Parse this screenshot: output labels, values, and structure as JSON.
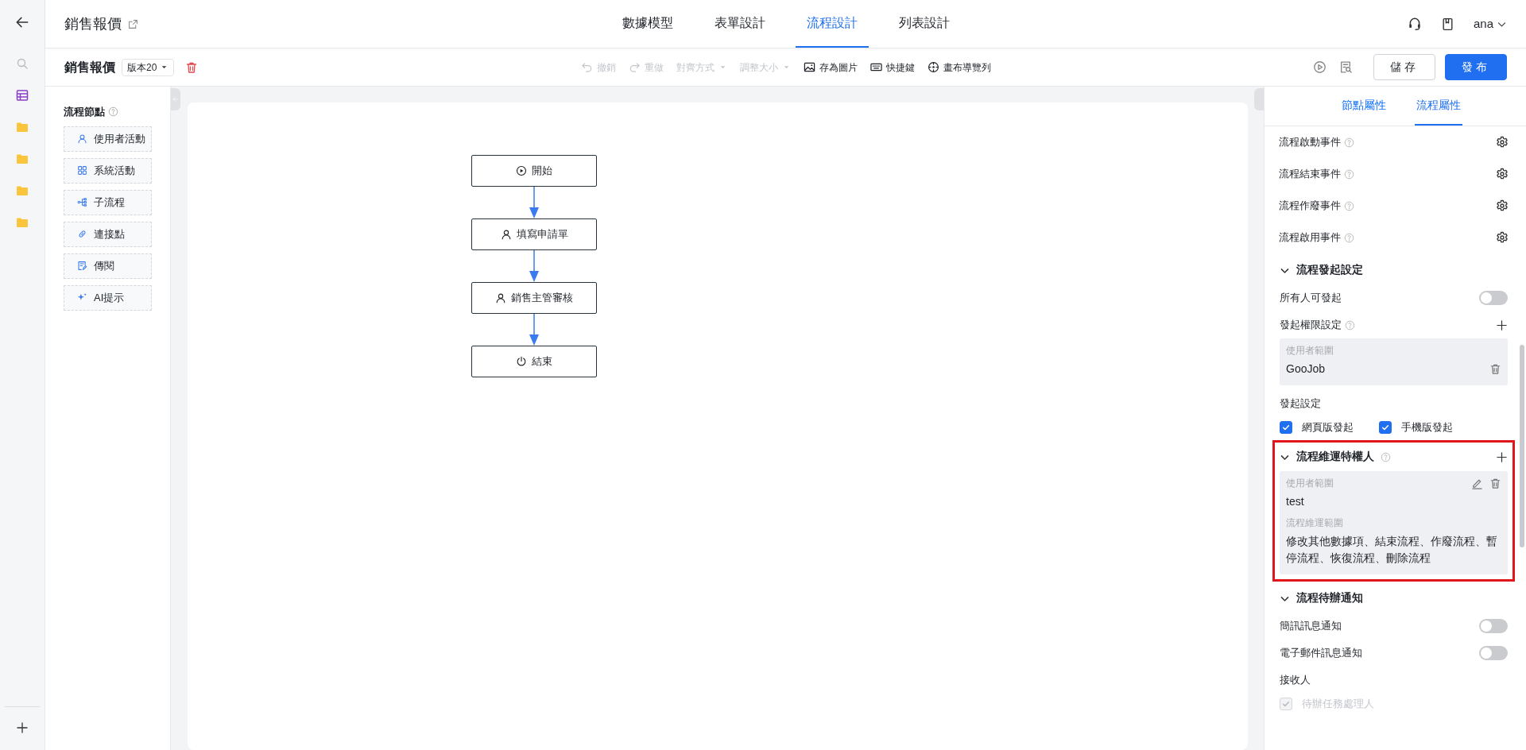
{
  "header": {
    "title": "銷售報價",
    "tabs": [
      {
        "label": "數據模型",
        "selected": false
      },
      {
        "label": "表單設計",
        "selected": false
      },
      {
        "label": "流程設計",
        "selected": true
      },
      {
        "label": "列表設計",
        "selected": false
      }
    ],
    "user": "ana"
  },
  "toolbar": {
    "title": "銷售報價",
    "version": "版本20",
    "tools": [
      {
        "label": "撤銷",
        "disabled": true,
        "dropdown": false
      },
      {
        "label": "重做",
        "disabled": true,
        "dropdown": false
      },
      {
        "label": "對齊方式",
        "disabled": true,
        "dropdown": true
      },
      {
        "label": "調整大小",
        "disabled": true,
        "dropdown": true
      },
      {
        "label": "存為圖片",
        "disabled": false,
        "dropdown": false
      },
      {
        "label": "快捷鍵",
        "disabled": false,
        "dropdown": false
      },
      {
        "label": "畫布導覽列",
        "disabled": false,
        "dropdown": false
      }
    ],
    "buttons": [
      {
        "label": "儲存",
        "kind": "secondary"
      },
      {
        "label": "發布",
        "kind": "primary"
      }
    ]
  },
  "node_palette": {
    "title": "流程節點",
    "items": [
      "使用者活動",
      "系統活動",
      "子流程",
      "連接點",
      "傳閱",
      "AI提示"
    ]
  },
  "flow": {
    "nodes": [
      {
        "label": "開始",
        "kind": "start"
      },
      {
        "label": "填寫申請單",
        "kind": "user"
      },
      {
        "label": "銷售主管審核",
        "kind": "user"
      },
      {
        "label": "結束",
        "kind": "end"
      }
    ]
  },
  "properties_panel": {
    "tabs": [
      {
        "label": "節點屬性",
        "selected": false
      },
      {
        "label": "流程屬性",
        "selected": true
      }
    ],
    "items": [
      {
        "kind": "event",
        "label": "流程啟動事件"
      },
      {
        "kind": "event",
        "label": "流程結束事件"
      },
      {
        "kind": "event",
        "label": "流程作廢事件"
      },
      {
        "kind": "event",
        "label": "流程啟用事件"
      },
      {
        "kind": "section",
        "label": "流程發起設定",
        "expanded": true,
        "help": false,
        "addable": false,
        "highlighted": false,
        "children": [
          {
            "kind": "toggle",
            "label": "所有人可發起",
            "on": false
          },
          {
            "kind": "adder",
            "label": "發起權限設定"
          },
          {
            "kind": "scope",
            "editable": false,
            "fields": [
              {
                "label": "使用者範圍",
                "value": "GooJob"
              }
            ]
          },
          {
            "kind": "label",
            "label": "發起設定"
          },
          {
            "kind": "checks",
            "options": [
              {
                "label": "網頁版發起",
                "checked": true,
                "disabled": false
              },
              {
                "label": "手機版發起",
                "checked": true,
                "disabled": false
              }
            ]
          }
        ]
      },
      {
        "kind": "section",
        "label": "流程維運特權人",
        "expanded": true,
        "help": true,
        "addable": true,
        "highlighted": true,
        "children": [
          {
            "kind": "scope",
            "editable": true,
            "fields": [
              {
                "label": "使用者範圍",
                "value": "test"
              },
              {
                "label": "流程維運範圍",
                "value": "修改其他數據項、結束流程、作廢流程、暫停流程、恢復流程、刪除流程"
              }
            ]
          }
        ]
      },
      {
        "kind": "section",
        "label": "流程待辦通知",
        "expanded": true,
        "help": false,
        "addable": false,
        "highlighted": false,
        "children": [
          {
            "kind": "toggle",
            "label": "簡訊訊息通知",
            "on": false
          },
          {
            "kind": "toggle",
            "label": "電子郵件訊息通知",
            "on": false
          },
          {
            "kind": "label",
            "label": "接收人"
          },
          {
            "kind": "checks",
            "options": [
              {
                "label": "待辦任務處理人",
                "checked": true,
                "disabled": true
              }
            ]
          }
        ]
      }
    ]
  }
}
